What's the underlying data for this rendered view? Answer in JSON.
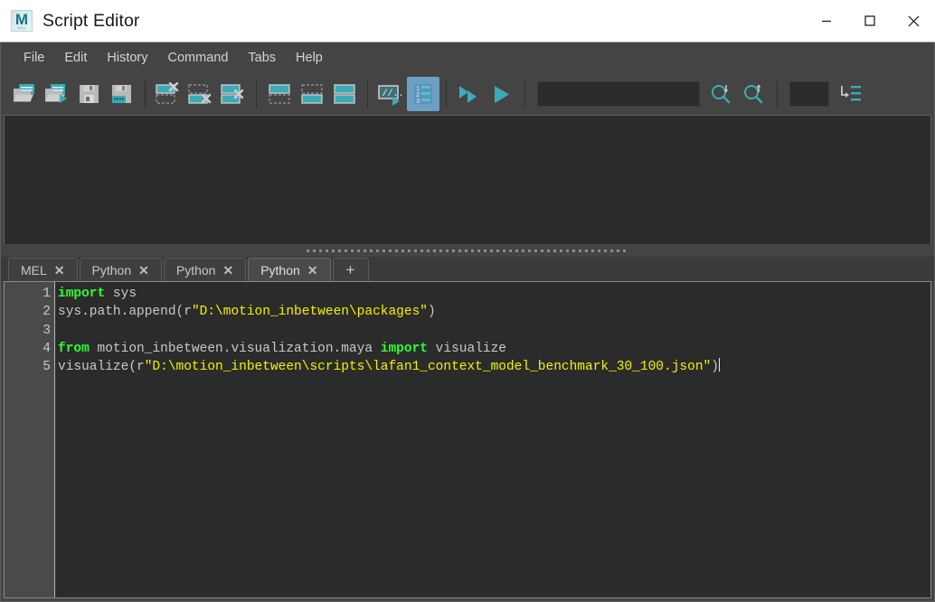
{
  "window": {
    "title": "Script Editor",
    "logo_letter": "M",
    "logo_sub": "MAYA",
    "controls": {
      "minimize": "minimize",
      "maximize": "maximize",
      "close": "close"
    }
  },
  "menubar": {
    "items": [
      {
        "label": "File"
      },
      {
        "label": "Edit"
      },
      {
        "label": "History"
      },
      {
        "label": "Command"
      },
      {
        "label": "Tabs"
      },
      {
        "label": "Help"
      }
    ]
  },
  "toolbar": {
    "groups": [
      {
        "buttons": [
          {
            "name": "open-script-icon",
            "title": "Open Script"
          },
          {
            "name": "open-and-execute-script-icon",
            "title": "Open and Execute Script"
          },
          {
            "name": "save-script-icon",
            "title": "Save Script"
          },
          {
            "name": "save-script-to-shelf-icon",
            "title": "Save Script to Shelf"
          }
        ]
      },
      {
        "buttons": [
          {
            "name": "clear-history-icon",
            "title": "Clear History"
          },
          {
            "name": "clear-input-icon",
            "title": "Clear Input"
          },
          {
            "name": "clear-all-icon",
            "title": "Clear All"
          }
        ]
      },
      {
        "buttons": [
          {
            "name": "select-history-icon",
            "title": "Select History"
          },
          {
            "name": "select-input-icon",
            "title": "Select Input"
          },
          {
            "name": "select-all-icon",
            "title": "Select All"
          }
        ]
      },
      {
        "buttons": [
          {
            "name": "script-to-shelf-icon",
            "title": "Copy Script to Shelf"
          },
          {
            "name": "show-line-numbers-icon",
            "title": "Show Line Numbers",
            "active": true
          }
        ]
      },
      {
        "buttons": [
          {
            "name": "execute-all-icon",
            "title": "Execute All"
          },
          {
            "name": "execute-icon",
            "title": "Execute"
          }
        ]
      }
    ],
    "search_field": {
      "value": "",
      "placeholder": ""
    },
    "search_down_icon": "search-down-icon",
    "search_up_icon": "search-up-icon",
    "line_field": {
      "value": "",
      "placeholder": ""
    },
    "goto_line_icon": "goto-line-icon"
  },
  "output": {
    "text": ""
  },
  "splitter": {
    "name": "horizontal-splitter"
  },
  "tabs": {
    "items": [
      {
        "label": "MEL",
        "close": "✕",
        "active": false
      },
      {
        "label": "Python",
        "close": "✕",
        "active": false
      },
      {
        "label": "Python",
        "close": "✕",
        "active": false
      },
      {
        "label": "Python",
        "close": "✕",
        "active": true
      }
    ],
    "add_label": "+"
  },
  "editor": {
    "line_numbers": [
      "1",
      "2",
      "3",
      "4",
      "5"
    ],
    "lines": [
      {
        "number": "1",
        "tokens": [
          {
            "t": "import",
            "c": "kw"
          },
          {
            "t": " sys",
            "c": "plain"
          }
        ]
      },
      {
        "number": "2",
        "tokens": [
          {
            "t": "sys.path.append(r",
            "c": "plain"
          },
          {
            "t": "\"D:\\motion_inbetween\\packages\"",
            "c": "str"
          },
          {
            "t": ")",
            "c": "plain"
          }
        ]
      },
      {
        "number": "3",
        "tokens": []
      },
      {
        "number": "4",
        "tokens": [
          {
            "t": "from",
            "c": "kw"
          },
          {
            "t": " motion_inbetween.visualization.maya ",
            "c": "plain"
          },
          {
            "t": "import",
            "c": "kw"
          },
          {
            "t": " visualize",
            "c": "plain"
          }
        ]
      },
      {
        "number": "5",
        "tokens": [
          {
            "t": "visualize(r",
            "c": "plain"
          },
          {
            "t": "\"D:\\motion_inbetween\\scripts\\lafan1_context_model_benchmark_30_100.json\"",
            "c": "str"
          },
          {
            "t": ")",
            "c": "plain"
          }
        ],
        "caret": true
      }
    ]
  },
  "colors": {
    "titlebar_bg": "#ffffff",
    "chrome_bg": "#444444",
    "panel_bg": "#2b2b2b",
    "gutter_bg": "#4a4a4a",
    "accent_teal": "#3cabb8",
    "active_toggle": "#6d9fc4",
    "keyword_green": "#2eff2e",
    "string_yellow": "#f2f200",
    "text_gray": "#c9c9c9"
  }
}
